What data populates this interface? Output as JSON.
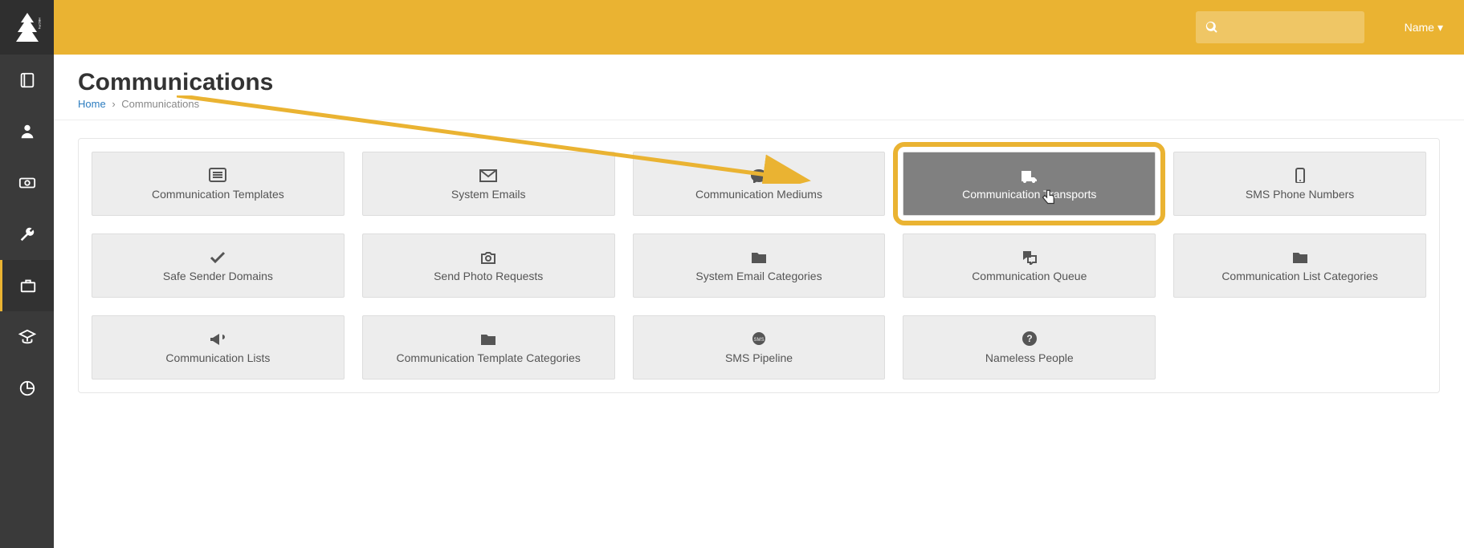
{
  "brand": {
    "name": "HBCPN"
  },
  "topbar": {
    "user_label": "Name",
    "search_placeholder": ""
  },
  "page": {
    "title": "Communications",
    "breadcrumb": {
      "home": "Home",
      "current": "Communications"
    }
  },
  "tiles": [
    {
      "id": "communication-templates",
      "label": "Communication Templates",
      "icon": "list"
    },
    {
      "id": "system-emails",
      "label": "System Emails",
      "icon": "envelope"
    },
    {
      "id": "communication-mediums",
      "label": "Communication Mediums",
      "icon": "comment"
    },
    {
      "id": "communication-transports",
      "label": "Communication Transports",
      "icon": "truck",
      "highlight": true
    },
    {
      "id": "sms-phone-numbers",
      "label": "SMS Phone Numbers",
      "icon": "phone"
    },
    {
      "id": "safe-sender-domains",
      "label": "Safe Sender Domains",
      "icon": "check"
    },
    {
      "id": "send-photo-requests",
      "label": "Send Photo Requests",
      "icon": "camera"
    },
    {
      "id": "system-email-categories",
      "label": "System Email Categories",
      "icon": "folder"
    },
    {
      "id": "communication-queue",
      "label": "Communication Queue",
      "icon": "chat"
    },
    {
      "id": "communication-list-categories",
      "label": "Communication List Categories",
      "icon": "folder"
    },
    {
      "id": "communication-lists",
      "label": "Communication Lists",
      "icon": "bullhorn"
    },
    {
      "id": "communication-template-categories",
      "label": "Communication Template Categories",
      "icon": "folder"
    },
    {
      "id": "sms-pipeline",
      "label": "SMS Pipeline",
      "icon": "sms"
    },
    {
      "id": "nameless-people",
      "label": "Nameless People",
      "icon": "question"
    }
  ],
  "sidebar_nav": [
    {
      "id": "nav-book",
      "icon": "book"
    },
    {
      "id": "nav-person",
      "icon": "person"
    },
    {
      "id": "nav-money",
      "icon": "money"
    },
    {
      "id": "nav-wrench",
      "icon": "wrench"
    },
    {
      "id": "nav-briefcase",
      "icon": "briefcase",
      "active": true
    },
    {
      "id": "nav-graduation",
      "icon": "graduation"
    },
    {
      "id": "nav-chart",
      "icon": "chart"
    }
  ]
}
